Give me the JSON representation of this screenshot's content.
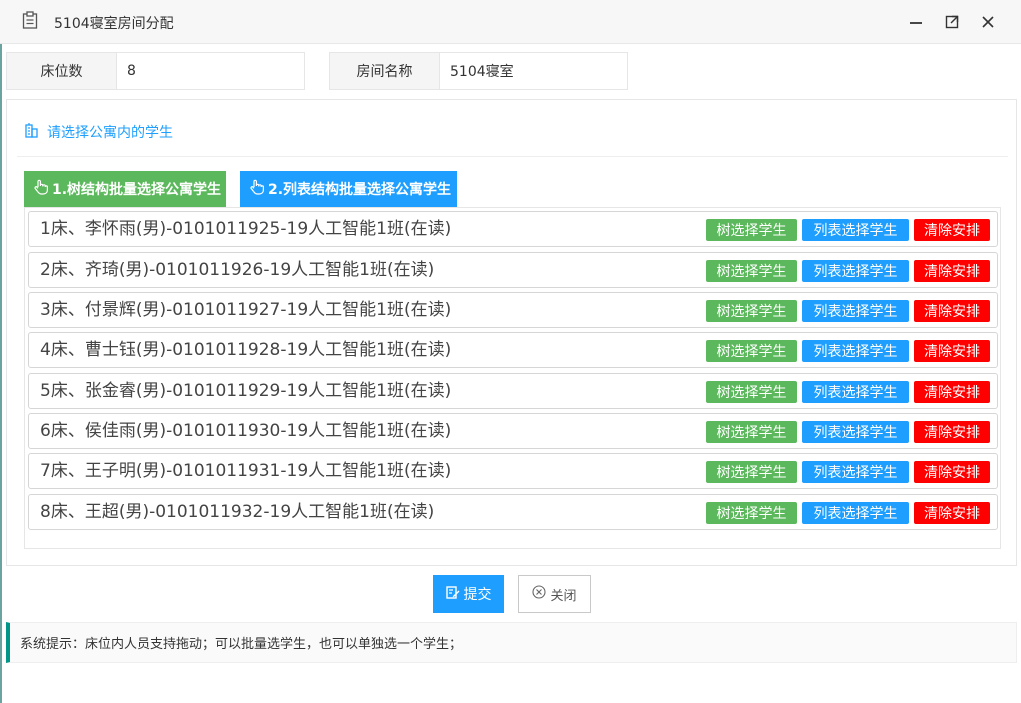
{
  "window": {
    "title": "5104寝室房间分配"
  },
  "fields": {
    "beds_label": "床位数",
    "beds_value": "8",
    "room_label": "房间名称",
    "room_value": "5104寝室"
  },
  "panel": {
    "heading": "请选择公寓内的学生",
    "tab_tree": "1.树结构批量选择公寓学生",
    "tab_list": "2.列表结构批量选择公寓学生"
  },
  "row_buttons": {
    "tree": "树选择学生",
    "list": "列表选择学生",
    "clear": "清除安排"
  },
  "beds": [
    {
      "text": "1床、李怀雨(男)-0101011925-19人工智能1班(在读)"
    },
    {
      "text": "2床、齐琦(男)-0101011926-19人工智能1班(在读)"
    },
    {
      "text": "3床、付景辉(男)-0101011927-19人工智能1班(在读)"
    },
    {
      "text": "4床、曹士钰(男)-0101011928-19人工智能1班(在读)"
    },
    {
      "text": "5床、张金睿(男)-0101011929-19人工智能1班(在读)"
    },
    {
      "text": "6床、侯佳雨(男)-0101011930-19人工智能1班(在读)"
    },
    {
      "text": "7床、王子明(男)-0101011931-19人工智能1班(在读)"
    },
    {
      "text": "8床、王超(男)-0101011932-19人工智能1班(在读)"
    }
  ],
  "actions": {
    "submit": "提交",
    "close": "关闭"
  },
  "tip": "系统提示：床位内人员支持拖动；可以批量选学生，也可以单独选一个学生；",
  "colors": {
    "primary": "#1e9fff",
    "success": "#5cb85c",
    "danger": "#ff0000",
    "tip_accent": "#009688"
  },
  "icons": {
    "title": "clipboard-icon",
    "minimize": "minimize-icon",
    "maximize": "maximize-icon",
    "close": "close-icon",
    "heading": "building-icon",
    "tab": "hand-pointer-icon",
    "submit": "edit-icon",
    "close_button": "circle-x-icon"
  }
}
